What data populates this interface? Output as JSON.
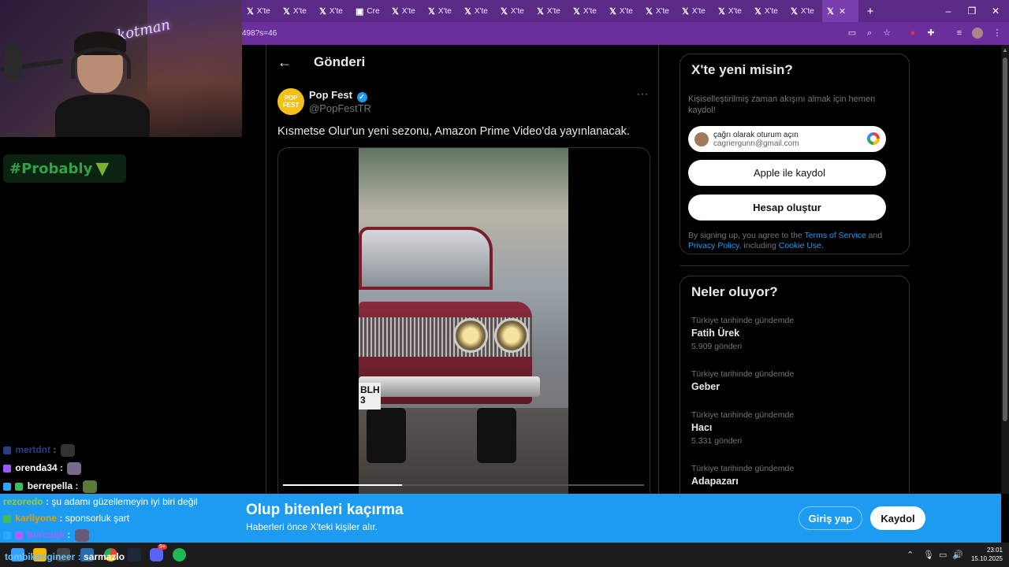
{
  "stream": {
    "neon_sign": "kotman",
    "overlay_badge": "#Probably",
    "chat": [
      {
        "user": "mertdnt",
        "message": "",
        "color": "#5b7cff"
      },
      {
        "user": "orenda34",
        "message": "",
        "color": "#ffffff"
      },
      {
        "user": "berrepella",
        "message": "",
        "color": "#ffffff"
      }
    ],
    "banner_chat": [
      {
        "user": "rezoredo",
        "message": "şu adamı güzellemeyin iyi biri değil",
        "color": "#9acd32"
      },
      {
        "user": "karliyone",
        "message": "sponsorluk şart",
        "color": "#e0a000"
      },
      {
        "user": "burcuqli",
        "message": "",
        "color": "#b05cff"
      }
    ],
    "taskbar_chat": {
      "user": "tombikengineer",
      "message": "sarmazlo"
    }
  },
  "browser": {
    "tabs": [
      {
        "label": "X'te",
        "icon": "x-logo"
      },
      {
        "label": "X'te",
        "icon": "x-logo"
      },
      {
        "label": "X'te",
        "icon": "x-logo"
      },
      {
        "label": "Cre",
        "icon": "doc-icon"
      },
      {
        "label": "X'te",
        "icon": "x-logo"
      },
      {
        "label": "X'te",
        "icon": "x-logo"
      },
      {
        "label": "X'te",
        "icon": "x-logo"
      },
      {
        "label": "X'te",
        "icon": "x-logo"
      },
      {
        "label": "X'te",
        "icon": "x-logo"
      },
      {
        "label": "X'te",
        "icon": "x-logo"
      },
      {
        "label": "X'te",
        "icon": "x-logo"
      },
      {
        "label": "X'te",
        "icon": "x-logo"
      },
      {
        "label": "X'te",
        "icon": "x-logo"
      },
      {
        "label": "X'te",
        "icon": "x-logo"
      },
      {
        "label": "X'te",
        "icon": "x-logo"
      },
      {
        "label": "X'te",
        "icon": "x-logo"
      },
      {
        "label": "X'te",
        "icon": "x-logo"
      }
    ],
    "active_tab_close": "✕",
    "new_tab": "+",
    "window_controls": {
      "minimize": "–",
      "maximize": "❐",
      "close": "✕"
    },
    "url": "498?s=46"
  },
  "post": {
    "header_title": "Gönderi",
    "author_name": "Pop Fest",
    "author_handle": "@PopFestTR",
    "avatar_text": "POP FEST",
    "text": "Kısmetse Olur'un yeni sezonu, Amazon Prime Video'da yayınlanacak.",
    "video_progress": 0.33,
    "plate_text": "BLH\n3"
  },
  "signup": {
    "title": "X'te yeni misin?",
    "subtitle": "Kişiselleştirilmiş zaman akışını almak için hemen kaydol!",
    "google_line1": "çağrı olarak oturum açın",
    "google_line2": "cagriergunn@gmail.com",
    "apple_label": "Apple ile kaydol",
    "create_label": "Hesap oluştur",
    "legal_prefix": "By signing up, you agree to the",
    "terms": "Terms of Service",
    "and": "and",
    "privacy": "Privacy Policy",
    "including": ", including",
    "cookie": "Cookie Use."
  },
  "trends": {
    "title": "Neler oluyor?",
    "items": [
      {
        "context": "Türkiye tarihinde gündemde",
        "name": "Fatih Ürek",
        "count": "5.909 gönderi"
      },
      {
        "context": "Türkiye tarihinde gündemde",
        "name": "Geber",
        "count": ""
      },
      {
        "context": "Türkiye tarihinde gündemde",
        "name": "Hacı",
        "count": "5.331 gönderi"
      },
      {
        "context": "Türkiye tarihinde gündemde",
        "name": "Adapazarı",
        "count": ""
      }
    ]
  },
  "banner": {
    "title": "Olup bitenleri kaçırma",
    "subtitle": "Haberleri önce X'teki kişiler alır.",
    "login": "Giriş yap",
    "signup": "Kaydol"
  },
  "taskbar": {
    "time": "23:01",
    "date": "15.10.2025",
    "notification_count": "9+"
  },
  "colors": {
    "accent": "#1d9bf0",
    "browser_tabbar": "#5b2a86",
    "browser_toolbar": "#6a2f9c"
  }
}
